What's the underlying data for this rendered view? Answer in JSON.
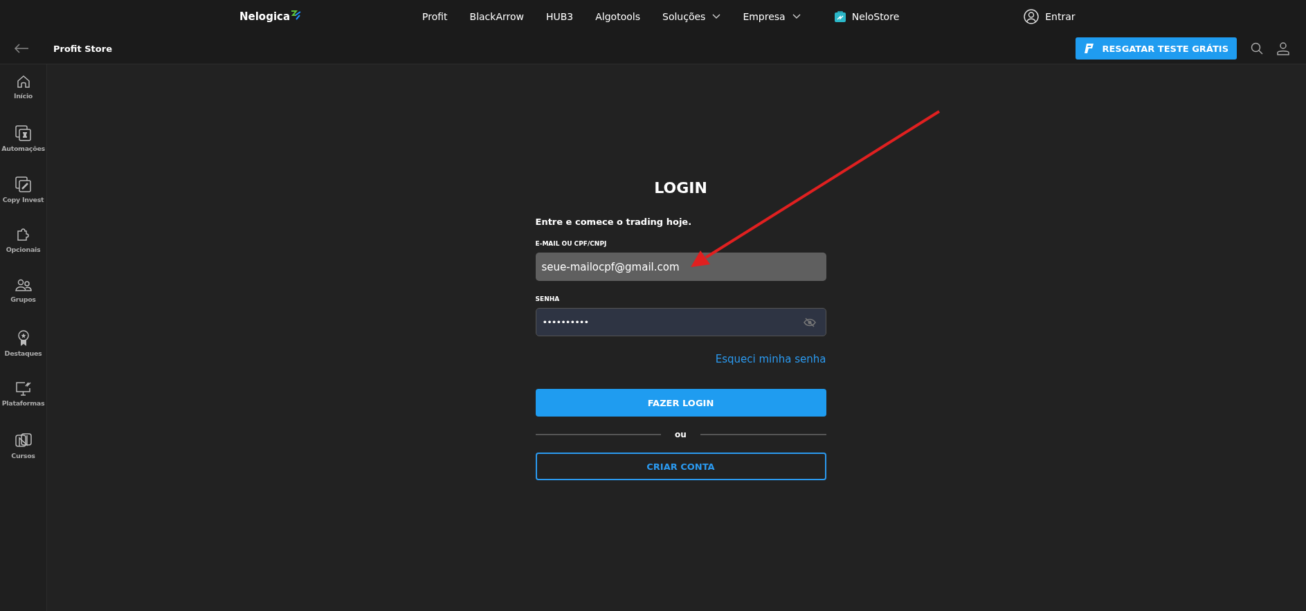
{
  "top_nav": {
    "logo": "Nelogica",
    "links": [
      {
        "label": "Profit",
        "dropdown": false
      },
      {
        "label": "BlackArrow",
        "dropdown": false
      },
      {
        "label": "HUB3",
        "dropdown": false
      },
      {
        "label": "Algotools",
        "dropdown": false
      },
      {
        "label": "Soluções",
        "dropdown": true
      },
      {
        "label": "Empresa",
        "dropdown": true
      }
    ],
    "store_link": "NeloStore",
    "sign_in": "Entrar"
  },
  "header": {
    "title": "Profit Store",
    "trial_button": "RESGATAR TESTE GRÁTIS"
  },
  "sidebar": {
    "items": [
      {
        "label": "Início"
      },
      {
        "label": "Automações"
      },
      {
        "label": "Copy Invest"
      },
      {
        "label": "Opcionais"
      },
      {
        "label": "Grupos"
      },
      {
        "label": "Destaques"
      },
      {
        "label": "Plataformas"
      },
      {
        "label": "Cursos"
      }
    ]
  },
  "login": {
    "title": "LOGIN",
    "subtitle": "Entre e comece o trading hoje.",
    "email_label": "E-MAIL OU CPF/CNPJ",
    "email_value": "seue-mailocpf@gmail.com",
    "password_label": "SENHA",
    "password_value": "••••••••••",
    "forgot_link": "Esqueci minha senha",
    "login_button": "FAZER LOGIN",
    "divider_text": "ou",
    "create_button": "CRIAR CONTA"
  }
}
